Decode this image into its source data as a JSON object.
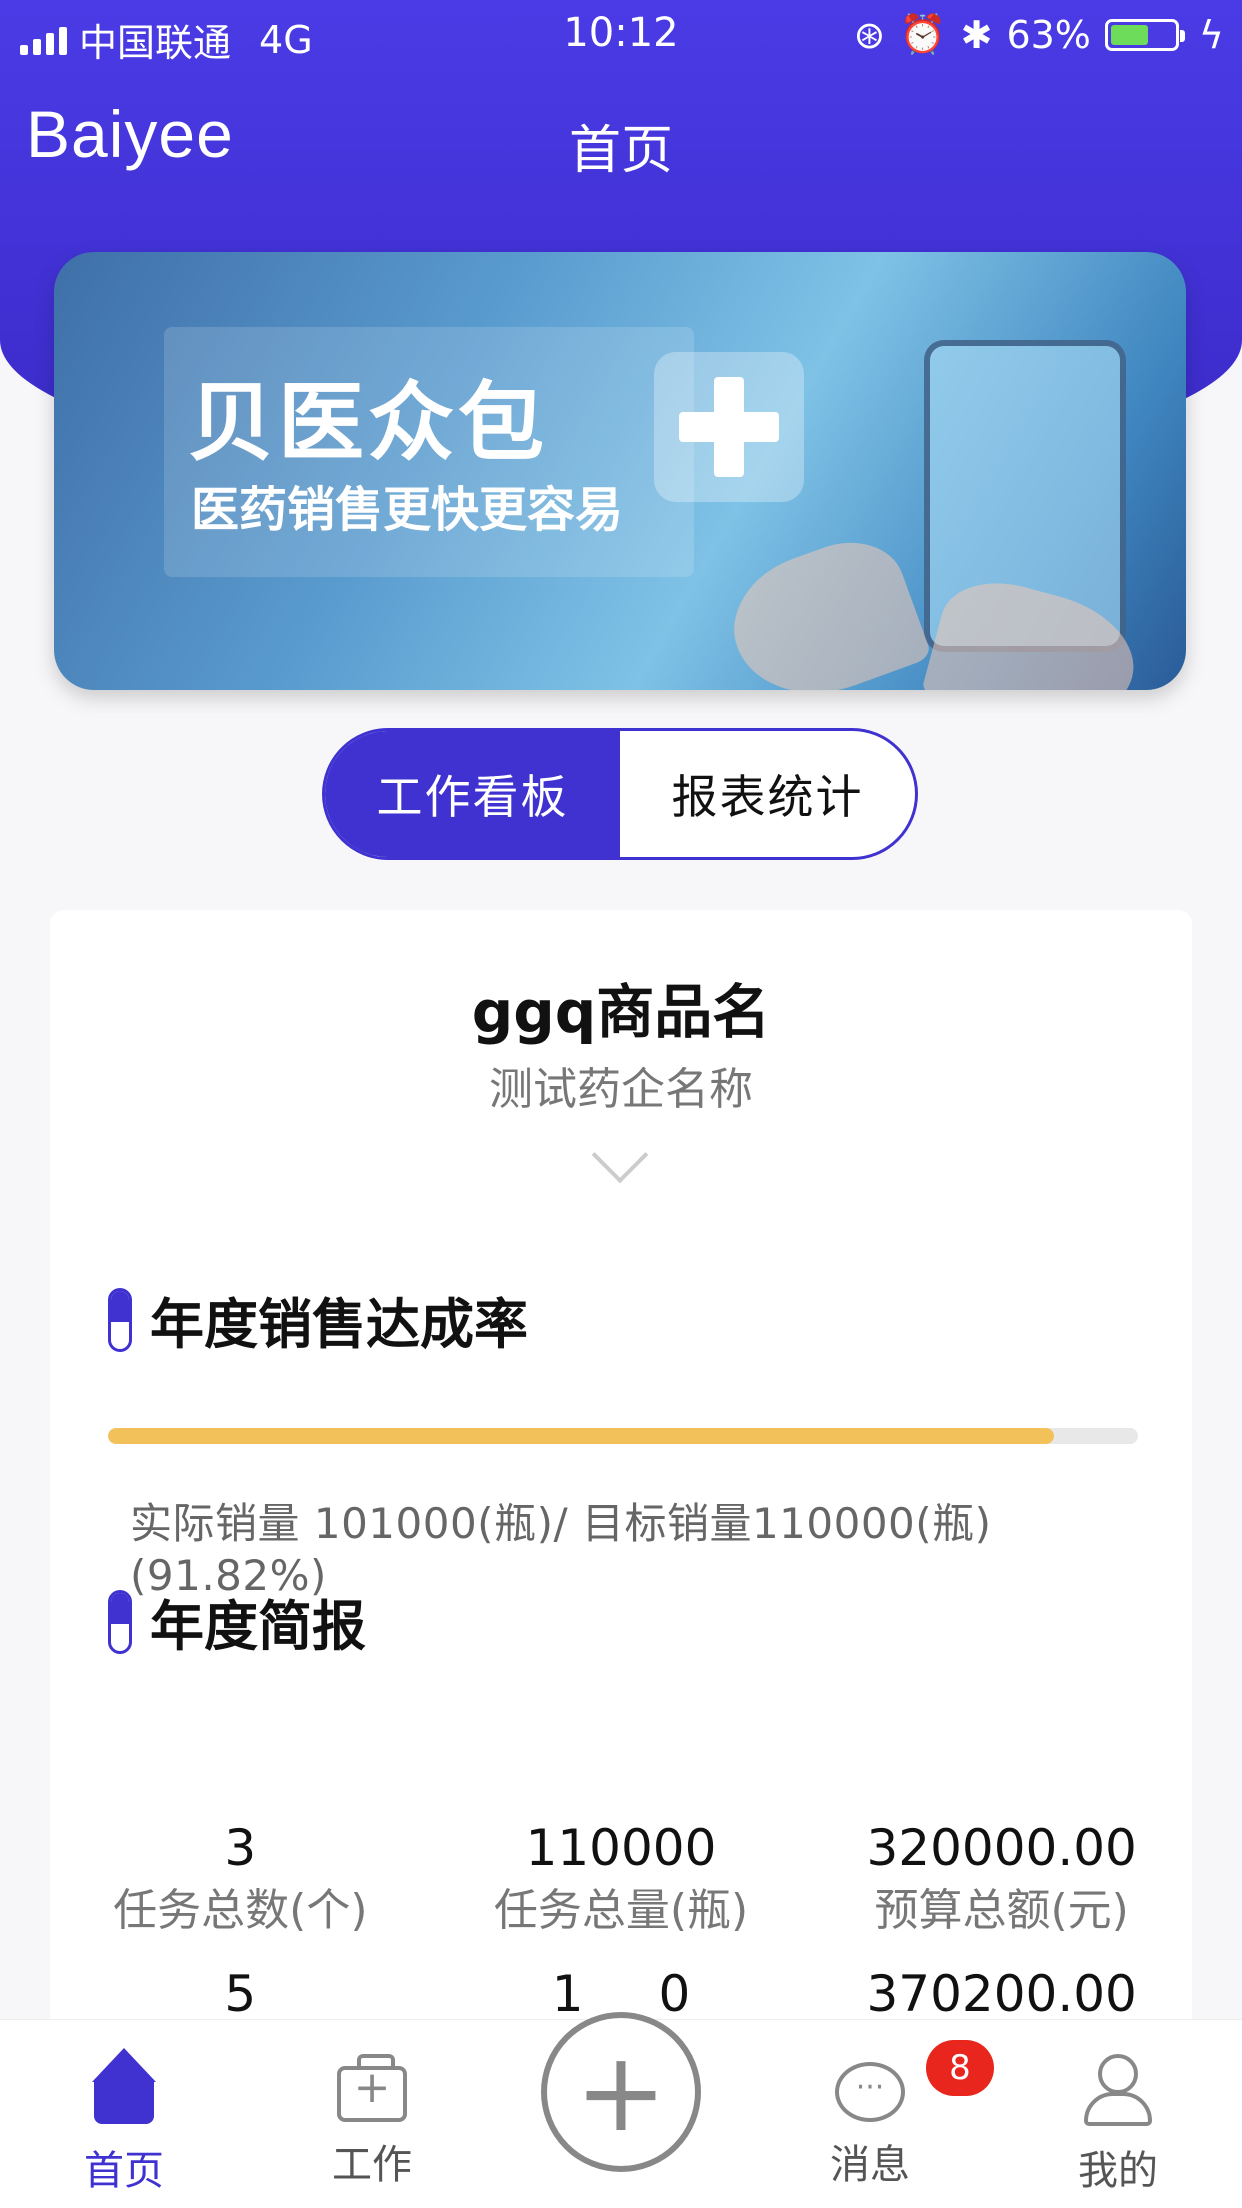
{
  "status_bar": {
    "carrier": "中国联通",
    "network": "4G",
    "time": "10:12",
    "battery_percent": "63%",
    "battery_level": 0.63,
    "icons": [
      "signal-icon",
      "lock-rotation-icon",
      "alarm-icon",
      "bluetooth-icon",
      "battery-icon",
      "charging-icon"
    ]
  },
  "header": {
    "logo": "Baiyee",
    "title": "首页",
    "accent_color": "#3f32d0"
  },
  "banner": {
    "title": "贝医众包",
    "subtitle": "医药销售更快更容易"
  },
  "segment": {
    "options": [
      "工作看板",
      "报表统计"
    ],
    "selected": "工作看板"
  },
  "product": {
    "name": "ggq商品名",
    "company": "测试药企名称"
  },
  "sales_rate": {
    "section_title": "年度销售达成率",
    "progress": 0.9182,
    "progress_color": "#f3c15a",
    "text": "实际销量 101000(瓶)/ 目标销量110000(瓶) (91.82%)"
  },
  "annual_report": {
    "section_title": "年度简报",
    "row1": [
      {
        "value": "3",
        "label": "任务总数(个)"
      },
      {
        "value": "110000",
        "label": "任务总量(瓶)"
      },
      {
        "value": "320000.00",
        "label": "预算总额(元)"
      }
    ],
    "row2": [
      {
        "value": "5"
      },
      {
        "value": "1___0"
      },
      {
        "value": "370200.00"
      }
    ]
  },
  "tabbar": {
    "items": [
      {
        "label": "首页",
        "icon": "home-icon",
        "active": true
      },
      {
        "label": "工作",
        "icon": "briefcase-icon",
        "active": false
      },
      {
        "label": "",
        "icon": "add-icon",
        "active": false
      },
      {
        "label": "消息",
        "icon": "message-icon",
        "active": false
      },
      {
        "label": "我的",
        "icon": "user-icon",
        "active": false
      }
    ],
    "message_badge": "8"
  }
}
